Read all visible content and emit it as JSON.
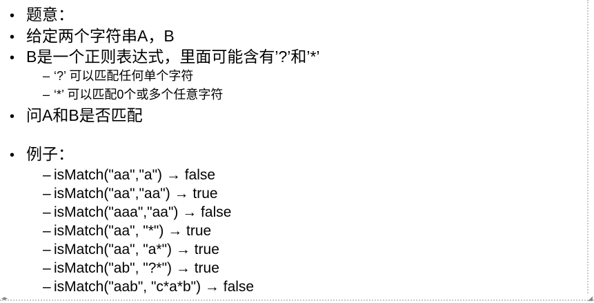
{
  "bullets": {
    "symbol": "•",
    "dash": "–"
  },
  "items": [
    "题意：",
    "给定两个字符串A，B",
    "B是一个正则表达式，里面可能含有’?’和’*’",
    "问A和B是否匹配",
    "例子："
  ],
  "rules": [
    "‘?’ 可以匹配任何单个字符",
    "‘*’ 可以匹配0个或多个任意字符"
  ],
  "examples": [
    "isMatch(\"aa\",\"a\") → false",
    "isMatch(\"aa\",\"aa\") → true",
    "isMatch(\"aaa\",\"aa\") → false",
    "isMatch(\"aa\", \"*\") → true",
    "isMatch(\"aa\", \"a*\") → true",
    "isMatch(\"ab\", \"?*\") → true",
    "isMatch(\"aab\", \"c*a*b\") → false"
  ],
  "corner_icons": {
    "left": "arrow-left-right-icon",
    "right": "resize-corner-icon"
  }
}
